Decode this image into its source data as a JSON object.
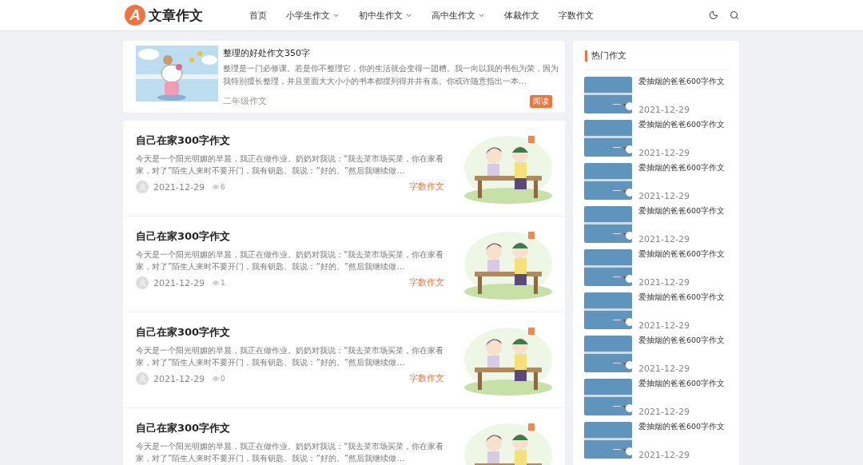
{
  "header": {
    "logo_letter": "A",
    "site_name": "文章作文",
    "nav": [
      {
        "label": "首页",
        "has_menu": false
      },
      {
        "label": "小学生作文",
        "has_menu": true
      },
      {
        "label": "初中生作文",
        "has_menu": true
      },
      {
        "label": "高中生作文",
        "has_menu": true
      },
      {
        "label": "体裁作文",
        "has_menu": false
      },
      {
        "label": "字数作文",
        "has_menu": false
      }
    ]
  },
  "featured": {
    "title": "整理的好处作文350字",
    "excerpt": "整理是一门必修课。若是你不整理它，你的生活就会变得一团糟。我一向以我的书包为荣，因为我特别擅长整理，并且里面大大小小的书本都摆列得井井有条。你或许随意指出一本…",
    "category": "二年级作文",
    "button": "阅读"
  },
  "posts": [
    {
      "title": "自己在家300字作文",
      "excerpt": "今天是一个阳光明媚的早晨，我正在做作业。奶奶对我说：“我去菜市场买菜，你在家看家，对了”陌生人来时不要开门，我有钥匙。我说：“好的。”然后我继续做…",
      "date": "2021-12-29",
      "views": "6",
      "category": "字数作文"
    },
    {
      "title": "自己在家300字作文",
      "excerpt": "今天是一个阳光明媚的早晨，我正在做作业。奶奶对我说：“我去菜市场买菜，你在家看家，对了”陌生人来时不要开门，我有钥匙。我说：“好的。”然后我继续做…",
      "date": "2021-12-29",
      "views": "1",
      "category": "字数作文"
    },
    {
      "title": "自己在家300字作文",
      "excerpt": "今天是一个阳光明媚的早晨，我正在做作业。奶奶对我说：“我去菜市场买菜，你在家看家，对了”陌生人来时不要开门，我有钥匙。我说：“好的。”然后我继续做…",
      "date": "2021-12-29",
      "views": "0",
      "category": "字数作文"
    },
    {
      "title": "自己在家300字作文",
      "excerpt": "今天是一个阳光明媚的早晨，我正在做作业。奶奶对我说：“我去菜市场买菜，你在家看家，对了”陌生人来时不要开门，我有钥匙。我说：“好的。”然后我继续做…"
    }
  ],
  "sidebar": {
    "title": "热门作文",
    "items": [
      {
        "title": "爱抽烟的爸爸600字作文",
        "date": "2021-12-29"
      },
      {
        "title": "爱抽烟的爸爸600字作文",
        "date": "2021-12-29"
      },
      {
        "title": "爱抽烟的爸爸600字作文",
        "date": "2021-12-29"
      },
      {
        "title": "爱抽烟的爸爸600字作文",
        "date": "2021-12-29"
      },
      {
        "title": "爱抽烟的爸爸600字作文",
        "date": "2021-12-29"
      },
      {
        "title": "爱抽烟的爸爸600字作文",
        "date": "2021-12-29"
      },
      {
        "title": "爱抽烟的爸爸600字作文",
        "date": "2021-12-29"
      },
      {
        "title": "爱抽烟的爸爸600字作文",
        "date": "2021-12-29"
      },
      {
        "title": "爱抽烟的爸爸600字作文",
        "date": "2021-12-29"
      }
    ]
  }
}
